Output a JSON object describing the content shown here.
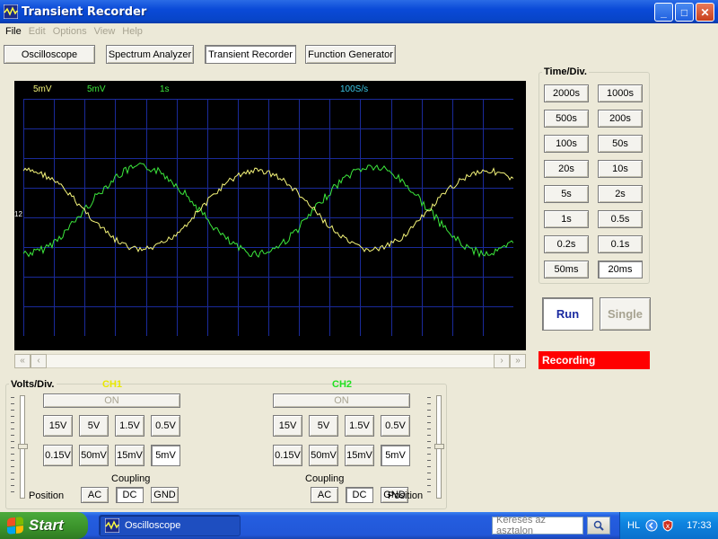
{
  "window": {
    "title": "Transient Recorder"
  },
  "menu": {
    "file": "File",
    "edit": "Edit",
    "options": "Options",
    "view": "View",
    "help": "Help"
  },
  "modes": {
    "oscilloscope": "Oscilloscope",
    "spectrum": "Spectrum Analyzer",
    "transient": "Transient Recorder",
    "generator": "Function Generator"
  },
  "scope": {
    "ch1_volts": "5mV",
    "ch2_volts": "5mV",
    "time_div": "1s",
    "sample_rate": "100S/s",
    "ch_marker": "12"
  },
  "time_div": {
    "label": "Time/Div.",
    "buttons": [
      "2000s",
      "1000s",
      "500s",
      "200s",
      "100s",
      "50s",
      "20s",
      "10s",
      "5s",
      "2s",
      "1s",
      "0.5s",
      "0.2s",
      "0.1s",
      "50ms",
      "20ms"
    ],
    "selected": "20ms"
  },
  "controls": {
    "run": "Run",
    "single": "Single",
    "status": "Recording"
  },
  "volts_div": {
    "label": "Volts/Div.",
    "ch1": {
      "name": "CH1",
      "on": "ON",
      "row1": [
        "15V",
        "5V",
        "1.5V",
        "0.5V"
      ],
      "row2": [
        "0.15V",
        "50mV",
        "15mV",
        "5mV"
      ],
      "selected": "5mV",
      "coupling_label": "Coupling",
      "coupling": [
        "AC",
        "DC",
        "GND"
      ],
      "coupling_selected": "DC",
      "position_label": "Position"
    },
    "ch2": {
      "name": "CH2",
      "on": "ON",
      "row1": [
        "15V",
        "5V",
        "1.5V",
        "0.5V"
      ],
      "row2": [
        "0.15V",
        "50mV",
        "15mV",
        "5mV"
      ],
      "selected": "5mV",
      "coupling_label": "Coupling",
      "coupling": [
        "AC",
        "DC",
        "GND"
      ],
      "coupling_selected": "DC",
      "position_label": "Position"
    }
  },
  "taskbar": {
    "start": "Start",
    "task": "Oscilloscope",
    "search_placeholder": "Keresés az asztalon",
    "lang": "HL",
    "clock": "17:33"
  },
  "colors": {
    "ch1": "#f5f57a",
    "ch2": "#3ce83c",
    "grid": "#1a2a9a",
    "screen": "#000000",
    "status": "#ff0000"
  }
}
